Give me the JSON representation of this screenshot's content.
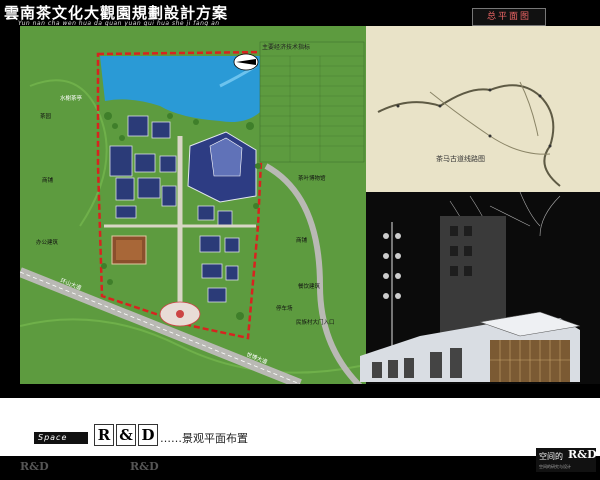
{
  "header": {
    "title": "雲南茶文化大觀園規劃設計方案",
    "pinyin": "Yun nan cha wen hua da guan yuan gui hua she ji fang an",
    "badge": "总平面图"
  },
  "plan": {
    "stats_title": "主要经济技术指标",
    "labels": {
      "water_pavilion": "水榭茶亭",
      "tea_garden": "茶园",
      "shops": "商铺",
      "office": "办公建筑",
      "tea_museum": "茶叶博物馆",
      "shops_2": "商铺",
      "dining": "餐饮建筑",
      "parking": "停车场",
      "village_entrance": "民族村大门入口",
      "road_1": "环山大道",
      "road_2": "世博大道"
    }
  },
  "route_map": {
    "caption": "茶马古道线路图"
  },
  "footer": {
    "space_label": "Space",
    "r_letter": "R",
    "amp": "&",
    "d_letter": "D",
    "subtitle": "……景观平面布置",
    "logo_line1": "空间的",
    "logo_line2": "R&D",
    "logo_line3": "空间的研究与设计",
    "ghost_1": "R&D",
    "ghost_2": "R&D"
  },
  "colors": {
    "background": "#000000",
    "grass": "#5d9b3f",
    "water": "#2a9ad6",
    "boundary": "#d8231f",
    "route_map_bg": "#e9e3c8"
  }
}
